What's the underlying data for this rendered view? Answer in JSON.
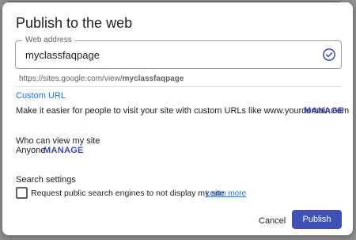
{
  "dialog": {
    "title": "Publish to the web",
    "web_address": {
      "label": "Web address",
      "value": "myclassfaqpage",
      "valid_icon": "check-circle-icon"
    },
    "url_prefix": "https://sites.google.com/view/",
    "url_slug": "myclassfaqpage",
    "custom_url": {
      "title": "Custom URL",
      "description": "Make it easier for people to visit your site with custom URLs like www.yourdomain.com",
      "manage_label": "MANAGE"
    },
    "visibility": {
      "title": "Who can view my site",
      "value": "Anyone",
      "manage_label": "MANAGE"
    },
    "search": {
      "title": "Search settings",
      "checkbox_label": "Request public search engines to not display my site",
      "checked": false,
      "learn_more": "Learn more"
    },
    "buttons": {
      "cancel": "Cancel",
      "publish": "Publish"
    }
  },
  "colors": {
    "accent": "#3f51b5",
    "link": "#1a73e8",
    "check": "#3949ab"
  }
}
